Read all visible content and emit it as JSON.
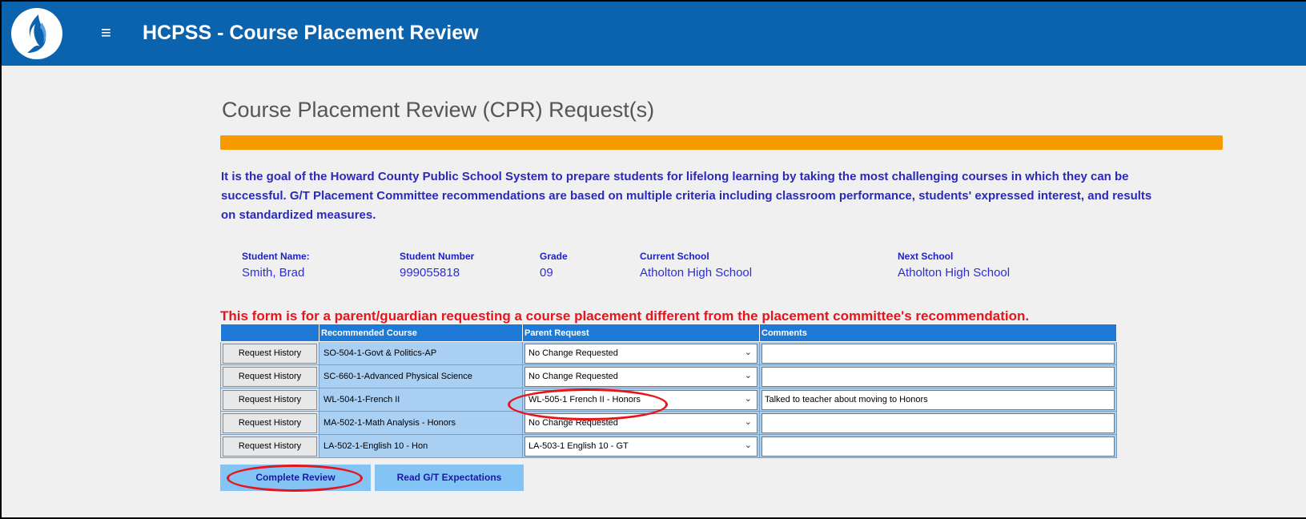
{
  "header": {
    "title": "HCPSS - Course Placement Review",
    "menu_icon": "hamburger-icon",
    "logo_icon": "hcpss-flame-logo",
    "bar_color": "#0c63ad"
  },
  "page": {
    "title": "Course Placement Review (CPR) Request(s)",
    "progress_color": "#f79a00",
    "goal_text": "It is the goal of the Howard County Public School System to prepare students for lifelong learning by taking the most challenging courses in which they can be successful. G/T Placement Committee recommendations are based on multiple criteria including classroom performance, students' expressed interest, and results on standardized measures."
  },
  "student": {
    "name_label": "Student Name:",
    "name": "Smith, Brad",
    "number_label": "Student Number",
    "number": "999055818",
    "grade_label": "Grade",
    "grade": "09",
    "current_school_label": "Current School",
    "current_school": "Atholton High School",
    "next_school_label": "Next School",
    "next_school": "Atholton High School"
  },
  "notice": "This form is for a parent/guardian requesting a course placement different from the placement committee's recommendation.",
  "table": {
    "headers": [
      "",
      "Recommended Course",
      "Parent Request",
      "Comments"
    ],
    "history_label": "Request History",
    "rows": [
      {
        "course": "SO-504-1-Govt & Politics-AP",
        "request": "No Change Requested",
        "comment": ""
      },
      {
        "course": "SC-660-1-Advanced Physical Science",
        "request": "No Change Requested",
        "comment": ""
      },
      {
        "course": "WL-504-1-French II",
        "request": "WL-505-1 French II - Honors",
        "comment": "Talked to teacher about moving to Honors"
      },
      {
        "course": "MA-502-1-Math Analysis - Honors",
        "request": "No Change Requested",
        "comment": ""
      },
      {
        "course": "LA-502-1-English 10 - Hon",
        "request": "LA-503-1 English 10 - GT",
        "comment": ""
      }
    ]
  },
  "buttons": {
    "complete_review": "Complete Review",
    "read_expectations": "Read G/T Expectations"
  },
  "annotation_color": "#e8141c"
}
